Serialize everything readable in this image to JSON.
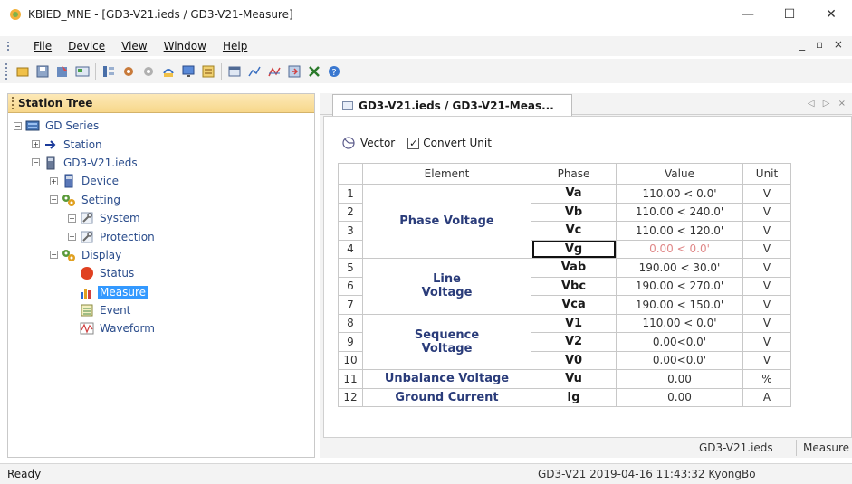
{
  "window": {
    "title": "KBIED_MNE - [GD3-V21.ieds / GD3-V21-Measure]",
    "controls": {
      "minimize": "—",
      "maximize": "☐",
      "close": "✕"
    }
  },
  "menu": {
    "items": [
      {
        "label": "File"
      },
      {
        "label": "Device"
      },
      {
        "label": "View"
      },
      {
        "label": "Window"
      },
      {
        "label": "Help"
      }
    ],
    "mdi_controls": "_ ▫ ×"
  },
  "toolbar": {
    "icons": [
      "new-icon",
      "save-icon",
      "open-icon",
      "connect-icon",
      "tree-icon",
      "settings-icon",
      "disconnect-icon",
      "download-icon",
      "monitor-icon",
      "list-icon",
      "window-icon",
      "chart-icon",
      "chart2-icon",
      "export-icon",
      "delete-icon",
      "help-icon"
    ]
  },
  "station_tree": {
    "header": "Station Tree",
    "nodes": [
      {
        "label": "GD Series",
        "level": 0,
        "expander": "−",
        "icon": "series-icon"
      },
      {
        "label": "Station",
        "level": 1,
        "expander": "+",
        "icon": "arrow-icon"
      },
      {
        "label": "GD3-V21.ieds",
        "level": 1,
        "expander": "−",
        "icon": "device-file-icon"
      },
      {
        "label": "Device",
        "level": 2,
        "expander": "+",
        "icon": "device-icon"
      },
      {
        "label": "Setting",
        "level": 2,
        "expander": "−",
        "icon": "gears-icon"
      },
      {
        "label": "System",
        "level": 3,
        "expander": "+",
        "icon": "wrench-icon"
      },
      {
        "label": "Protection",
        "level": 3,
        "expander": "+",
        "icon": "wrench-icon"
      },
      {
        "label": "Display",
        "level": 2,
        "expander": "−",
        "icon": "gears-icon"
      },
      {
        "label": "Status",
        "level": 3,
        "expander": "",
        "icon": "status-icon"
      },
      {
        "label": "Measure",
        "level": 3,
        "expander": "",
        "icon": "measure-icon",
        "selected": true
      },
      {
        "label": "Event",
        "level": 3,
        "expander": "",
        "icon": "event-icon"
      },
      {
        "label": "Waveform",
        "level": 3,
        "expander": "",
        "icon": "waveform-icon"
      }
    ]
  },
  "tab": {
    "label": "GD3-V21.ieds / GD3-V21-Meas...",
    "nav": "◁ ▷ ×"
  },
  "measure": {
    "vector_label": "Vector",
    "convert_unit_label": "Convert Unit",
    "convert_unit_checked": true,
    "columns": [
      "Element",
      "Phase",
      "Value",
      "Unit"
    ],
    "groups": [
      {
        "element": "Phase Voltage",
        "rows": [
          {
            "num": "1",
            "phase": "Va",
            "value": "110.00 < 0.0'",
            "unit": "V"
          },
          {
            "num": "2",
            "phase": "Vb",
            "value": "110.00 < 240.0'",
            "unit": "V"
          },
          {
            "num": "3",
            "phase": "Vc",
            "value": "110.00 < 120.0'",
            "unit": "V"
          },
          {
            "num": "4",
            "phase": "Vg",
            "value": "0.00 < 0.0'",
            "unit": "V",
            "grayed": true,
            "focused": true
          }
        ]
      },
      {
        "element": "Line Voltage",
        "rows": [
          {
            "num": "5",
            "phase": "Vab",
            "value": "190.00 < 30.0'",
            "unit": "V"
          },
          {
            "num": "6",
            "phase": "Vbc",
            "value": "190.00 < 270.0'",
            "unit": "V"
          },
          {
            "num": "7",
            "phase": "Vca",
            "value": "190.00 < 150.0'",
            "unit": "V"
          }
        ]
      },
      {
        "element": "Sequence Voltage",
        "rows": [
          {
            "num": "8",
            "phase": "V1",
            "value": "110.00 < 0.0'",
            "unit": "V"
          },
          {
            "num": "9",
            "phase": "V2",
            "value": "0.00<0.0'",
            "unit": "V"
          },
          {
            "num": "10",
            "phase": "V0",
            "value": "0.00<0.0'",
            "unit": "V"
          }
        ]
      },
      {
        "element": "Unbalance Voltage",
        "rows": [
          {
            "num": "11",
            "phase": "Vu",
            "value": "0.00",
            "unit": "%"
          }
        ]
      },
      {
        "element": "Ground Current",
        "rows": [
          {
            "num": "12",
            "phase": "Ig",
            "value": "0.00",
            "unit": "A"
          }
        ]
      }
    ]
  },
  "content_footer": {
    "device_name": "GD3-V21.ieds",
    "mode": "Measure"
  },
  "statusbar": {
    "left": "Ready",
    "right": "GD3-V21  2019-04-16 11:43:32  KyongBo"
  }
}
